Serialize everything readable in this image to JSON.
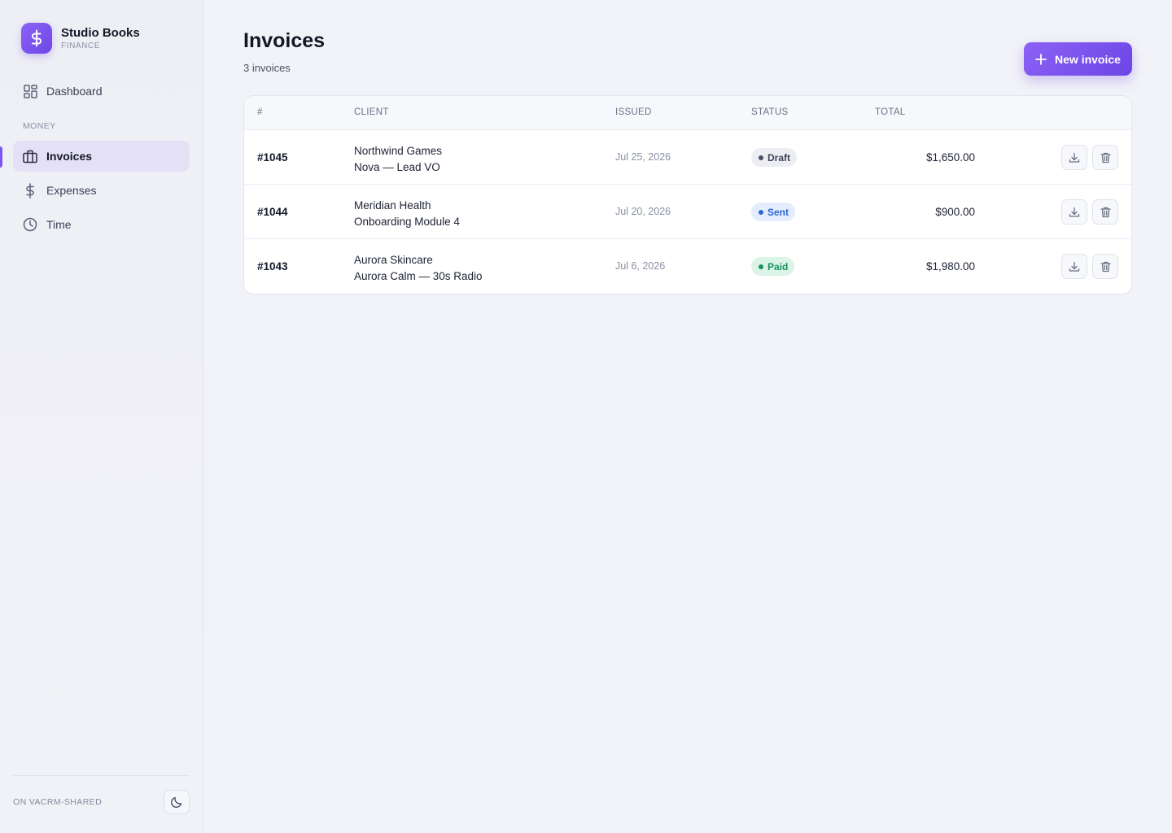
{
  "brand": {
    "name": "Studio Books",
    "subtitle": "FINANCE",
    "icon": "dollar-icon",
    "accent": "#7c57ee"
  },
  "sidebar": {
    "items": [
      {
        "label": "Dashboard",
        "icon": "grid-icon",
        "active": false
      },
      {
        "label": "Invoices",
        "icon": "briefcase-icon",
        "active": true
      },
      {
        "label": "Expenses",
        "icon": "dollar-icon",
        "active": false
      },
      {
        "label": "Time",
        "icon": "clock-icon",
        "active": false
      }
    ],
    "section_label": "MONEY",
    "workspace_label": "ON VACRM-SHARED",
    "theme_toggle_icon": "moon-icon"
  },
  "page": {
    "title": "Invoices",
    "count": "3 invoices",
    "new_button_label": "New invoice"
  },
  "table": {
    "columns": [
      "#",
      "CLIENT",
      "ISSUED",
      "STATUS",
      "TOTAL"
    ],
    "rows": [
      {
        "number": "#1045",
        "client": "Northwind Games",
        "project": "Nova — Lead VO",
        "issued": "Jul 25, 2026",
        "status": "Draft",
        "total": "$1,650.00"
      },
      {
        "number": "#1044",
        "client": "Meridian Health",
        "project": "Onboarding Module 4",
        "issued": "Jul 20, 2026",
        "status": "Sent",
        "total": "$900.00"
      },
      {
        "number": "#1043",
        "client": "Aurora Skincare",
        "project": "Aurora Calm — 30s Radio",
        "issued": "Jul 6, 2026",
        "status": "Paid",
        "total": "$1,980.00"
      }
    ]
  },
  "status_colors": {
    "Draft": "#4a5066",
    "Sent": "#2d66d9",
    "Paid": "#16935a"
  }
}
